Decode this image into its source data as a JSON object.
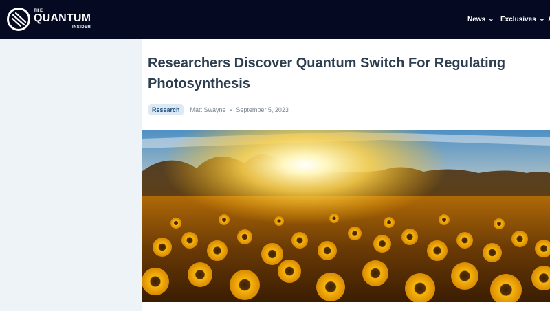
{
  "header": {
    "logo": {
      "the": "THE",
      "name": "QUANTUM",
      "insider": "INSIDER"
    },
    "nav": [
      {
        "label": "News",
        "icon": "chevron-down-icon"
      },
      {
        "label": "Exclusives",
        "icon": "chevron-down-icon"
      },
      {
        "label": "A",
        "icon": ""
      }
    ]
  },
  "article": {
    "title": "Researchers Discover Quantum Switch For Regulating Photosynthesis",
    "category": "Research",
    "author": "Matt Swayne",
    "separator": "•",
    "date": "September 5, 2023",
    "hero_image": "sunflower-field-sunset"
  },
  "colors": {
    "topbar": "#050921",
    "title": "#2c3e50",
    "badge_bg": "#dde9f5",
    "badge_text": "#1b4f7e",
    "page_bg": "#eef3f8"
  }
}
